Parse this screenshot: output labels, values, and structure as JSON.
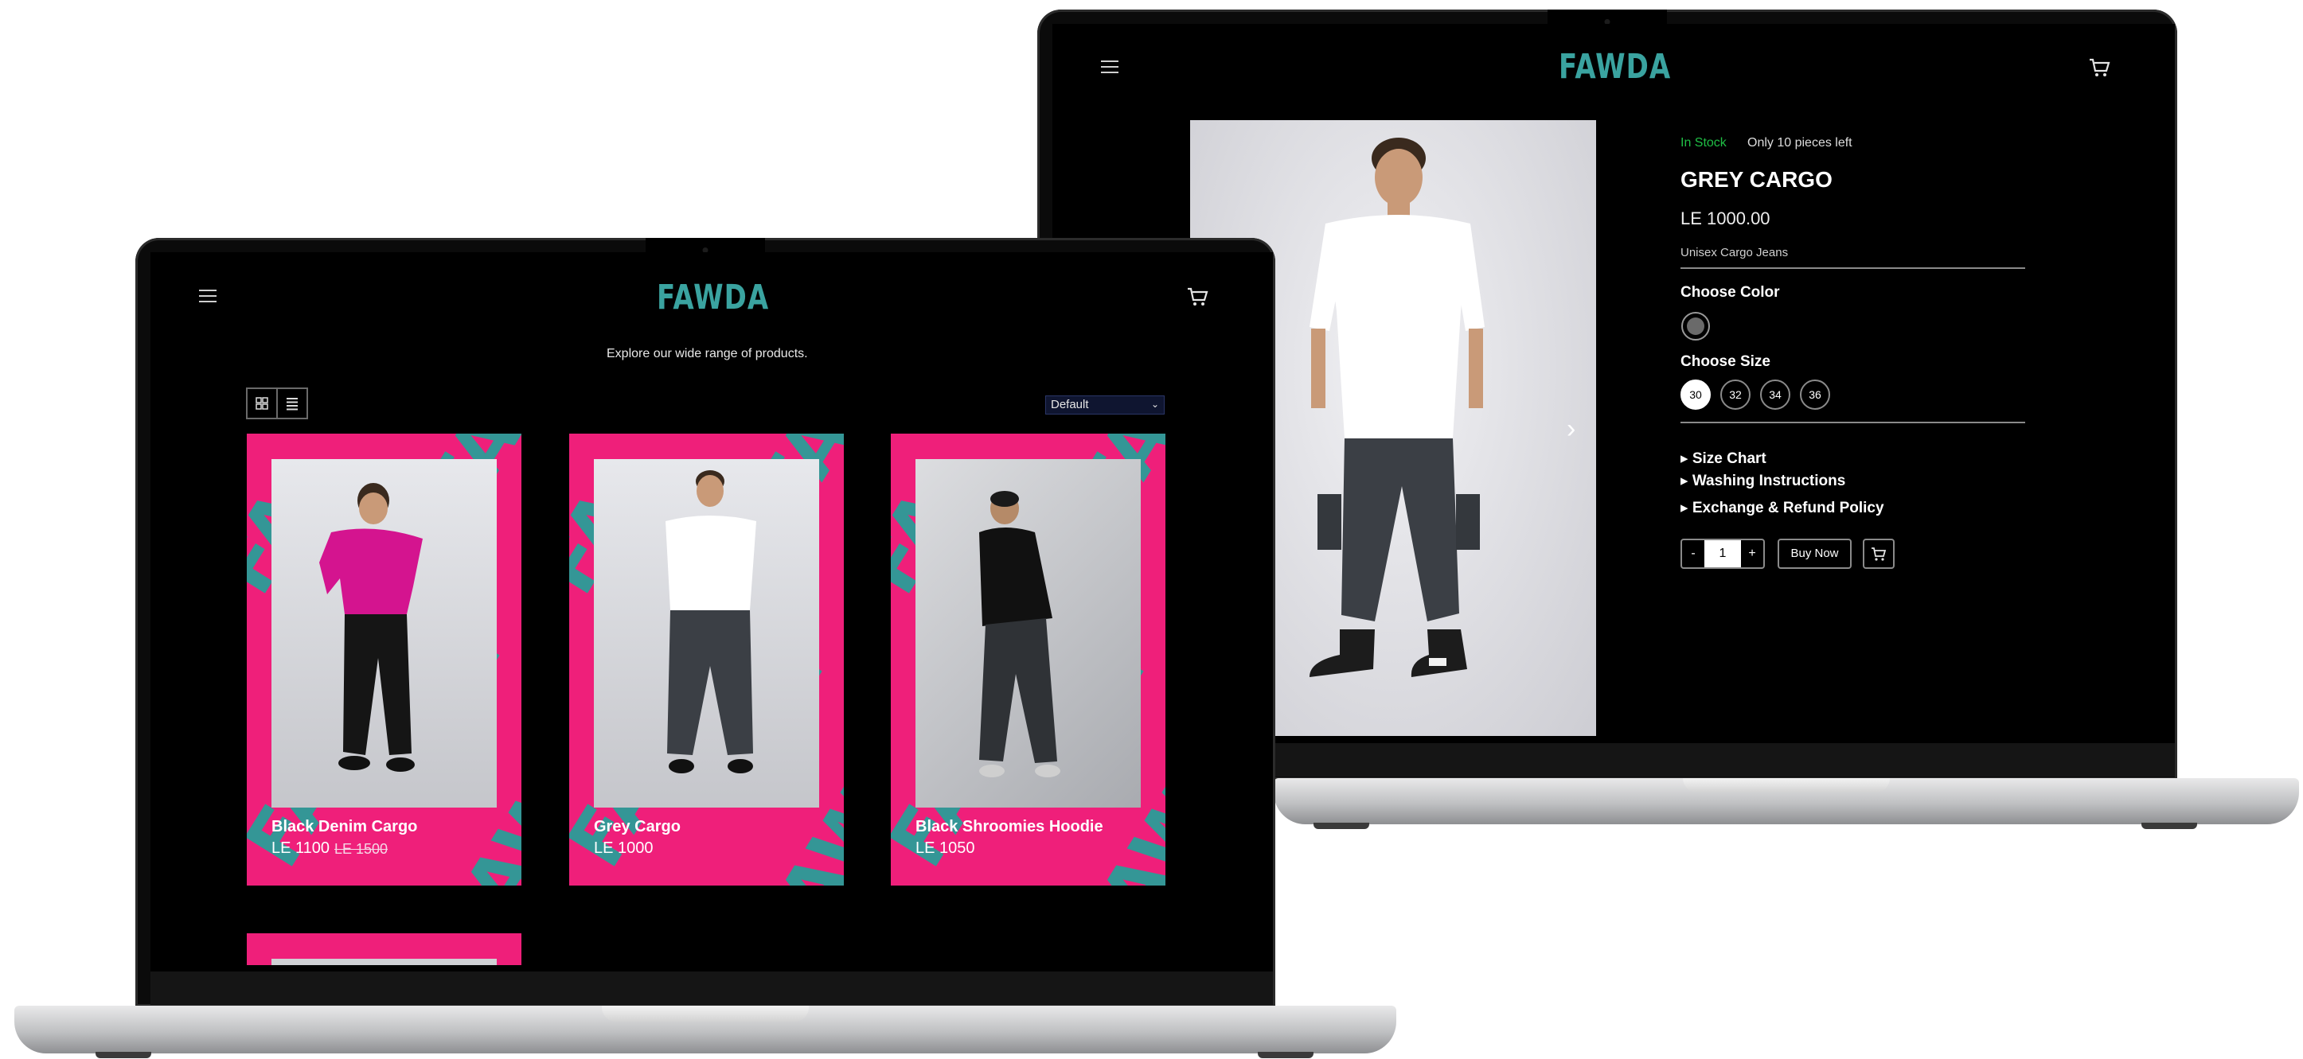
{
  "shop": {
    "logo": "FAWDA",
    "tagline": "Explore our wide range of products.",
    "sort_selected": "Default",
    "products": [
      {
        "name": "Black Denim Cargo",
        "price": "LE 1100",
        "old_price": "LE 1500",
        "shirt": "#d4148f",
        "pants": "#151515"
      },
      {
        "name": "Grey Cargo",
        "price": "LE 1000",
        "old_price": "",
        "shirt": "#ffffff",
        "pants": "#3b3f45"
      },
      {
        "name": "Black Shroomies Hoodie",
        "price": "LE 1050",
        "old_price": "",
        "shirt": "#111111",
        "pants": "#2f3236"
      }
    ]
  },
  "detail": {
    "logo": "FAWDA",
    "stock": "In Stock",
    "stock_note": "Only 10 pieces left",
    "title": "GREY CARGO",
    "price": "LE 1000.00",
    "subtitle": "Unisex Cargo Jeans",
    "choose_color": "Choose Color",
    "choose_size": "Choose Size",
    "sizes": [
      "30",
      "32",
      "34",
      "36"
    ],
    "selected_size": "30",
    "accordions": [
      "Size Chart",
      "Washing Instructions",
      "Exchange & Refund Policy"
    ],
    "qty_minus": "-",
    "qty_value": "1",
    "qty_plus": "+",
    "buy_now": "Buy Now"
  },
  "colors": {
    "accent": "#3aa3a0",
    "card_pink": "#ef1f7a",
    "stock_green": "#1fbf45"
  }
}
